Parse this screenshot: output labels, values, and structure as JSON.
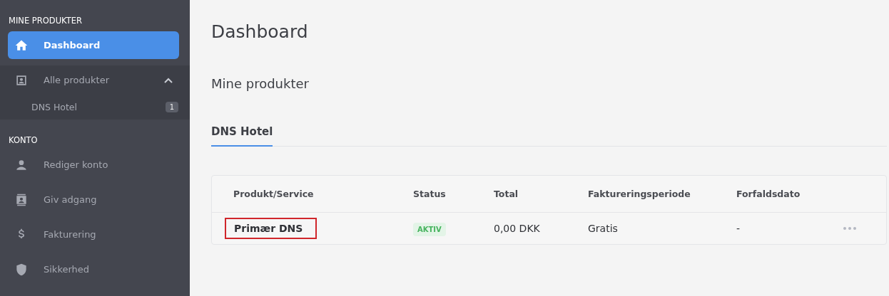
{
  "sidebar": {
    "sections": [
      {
        "heading": "MINE PRODUKTER",
        "items": [
          {
            "label": "Dashboard",
            "selected": true
          },
          {
            "label": "Alle produkter",
            "selected": false,
            "expanded": true,
            "children": [
              {
                "label": "DNS Hotel",
                "badge": "1"
              }
            ]
          }
        ]
      },
      {
        "heading": "KONTO",
        "items": [
          {
            "label": "Rediger konto",
            "selected": false
          },
          {
            "label": "Giv adgang",
            "selected": false
          },
          {
            "label": "Fakturering",
            "selected": false
          },
          {
            "label": "Sikkerhed",
            "selected": false
          }
        ]
      }
    ]
  },
  "page_title": "Dashboard",
  "section_title": "Mine produkter",
  "tabs": [
    {
      "label": "DNS Hotel",
      "selected": true
    }
  ],
  "table": {
    "columns": [
      "Produkt/Service",
      "Status",
      "Total",
      "Faktureringsperiode",
      "Forfaldsdato"
    ],
    "rows": [
      {
        "product": "Primær DNS",
        "highlighted": true,
        "status": "AKTIV",
        "total": "0,00 DKK",
        "period": "Gratis",
        "due": "-"
      }
    ]
  }
}
